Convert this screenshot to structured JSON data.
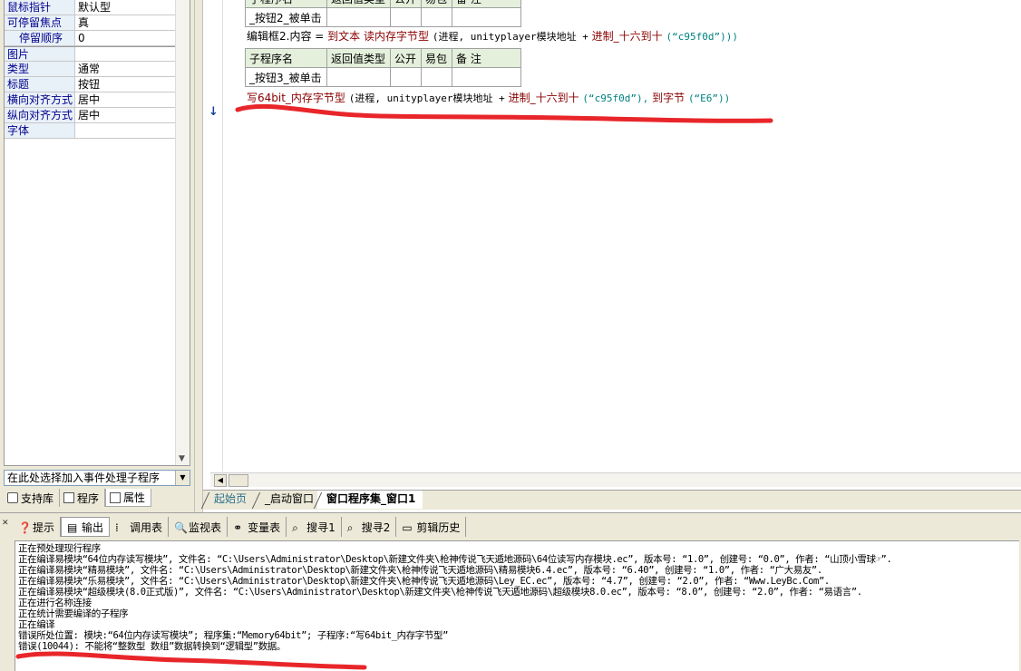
{
  "properties": [
    {
      "name": "鼠标指针",
      "value": "默认型",
      "indent": false,
      "sep": false
    },
    {
      "name": "可停留焦点",
      "value": "真",
      "indent": false,
      "sep": false
    },
    {
      "name": "停留顺序",
      "value": "0",
      "indent": true,
      "sep": false
    },
    {
      "name": "图片",
      "value": "",
      "indent": false,
      "sep": true
    },
    {
      "name": "类型",
      "value": "通常",
      "indent": false,
      "sep": false
    },
    {
      "name": "标题",
      "value": "按钮",
      "indent": false,
      "sep": false
    },
    {
      "name": "横向对齐方式",
      "value": "居中",
      "indent": false,
      "sep": false
    },
    {
      "name": "纵向对齐方式",
      "value": "居中",
      "indent": false,
      "sep": false
    },
    {
      "name": "字体",
      "value": "",
      "indent": false,
      "sep": false
    }
  ],
  "event_select": {
    "text": "在此处选择加入事件处理子程序"
  },
  "left_tabs": {
    "support": "支持库",
    "program": "程序",
    "property": "属性"
  },
  "editor": {
    "table1": {
      "headers": [
        "子程序名",
        "返回值类型",
        "公开",
        "易包",
        "备 注"
      ],
      "row": [
        "_按钮2_被单击",
        "",
        "",
        "",
        ""
      ]
    },
    "line1": {
      "target": "编辑框2.内容",
      "eq": "=",
      "fn1": "到文本",
      "fn2": "读内存字节型",
      "args": "(进程, unityplayer模块地址 +",
      "fn3": "进制_十六到十",
      "str": "(“c95f0d”)))"
    },
    "table2": {
      "headers": [
        "子程序名",
        "返回值类型",
        "公开",
        "易包",
        "备 注"
      ],
      "row": [
        "_按钮3_被单击",
        "",
        "",
        "",
        ""
      ]
    },
    "line2": {
      "fn1": "写64bit_内存字节型",
      "args": "(进程, unityplayer模块地址 +",
      "fn2": "进制_十六到十",
      "str": "(“c95f0d”),",
      "fn3": "到字节",
      "str2": "(“E6”))"
    }
  },
  "editor_tabs": [
    "起始页",
    "_启动窗口",
    "窗口程序集_窗口1"
  ],
  "output_tabs": [
    "提示",
    "输出",
    "调用表",
    "监视表",
    "变量表",
    "搜寻1",
    "搜寻2",
    "剪辑历史"
  ],
  "output_lines": [
    "正在预处理现行程序",
    "正在编译易模块“64位内存读写模块”, 文件名: “C:\\Users\\Administrator\\Desktop\\新建文件夹\\枪神传说飞天遁地源码\\64位读写内存模块.ec”, 版本号: “1.0”, 创建号: “0.0”, 作者: “山顶小雪球☞”.",
    "正在编译易模块“精易模块”, 文件名: “C:\\Users\\Administrator\\Desktop\\新建文件夹\\枪神传说飞天遁地源码\\精易模块6.4.ec”, 版本号: “6.40”, 创建号: “1.0”, 作者: “广大易友”.",
    "正在编译易模块“乐易模块”, 文件名: “C:\\Users\\Administrator\\Desktop\\新建文件夹\\枪神传说飞天遁地源码\\Ley_EC.ec”, 版本号: “4.7”, 创建号: “2.0”, 作者: “Www.LeyBc.Com”.",
    "正在编译易模块“超级模块(8.0正式版)”, 文件名: “C:\\Users\\Administrator\\Desktop\\新建文件夹\\枪神传说飞天遁地源码\\超级模块8.0.ec”, 版本号: “8.0”, 创建号: “2.0”, 作者: “易语言”.",
    "正在进行名称连接",
    "正在统计需要编译的子程序",
    "正在编译",
    "错误所处位置: 模块:“64位内存读写模块”; 程序集:“Memory64bit”; 子程序:“写64bit_内存字节型”",
    "错误(10044): 不能将“整数型 数组”数据转换到“逻辑型”数据。"
  ],
  "colors": {
    "annotation": "#e8262a",
    "function": "#8b0000",
    "string": "#008080",
    "header_bg": "#e4f0dc"
  }
}
